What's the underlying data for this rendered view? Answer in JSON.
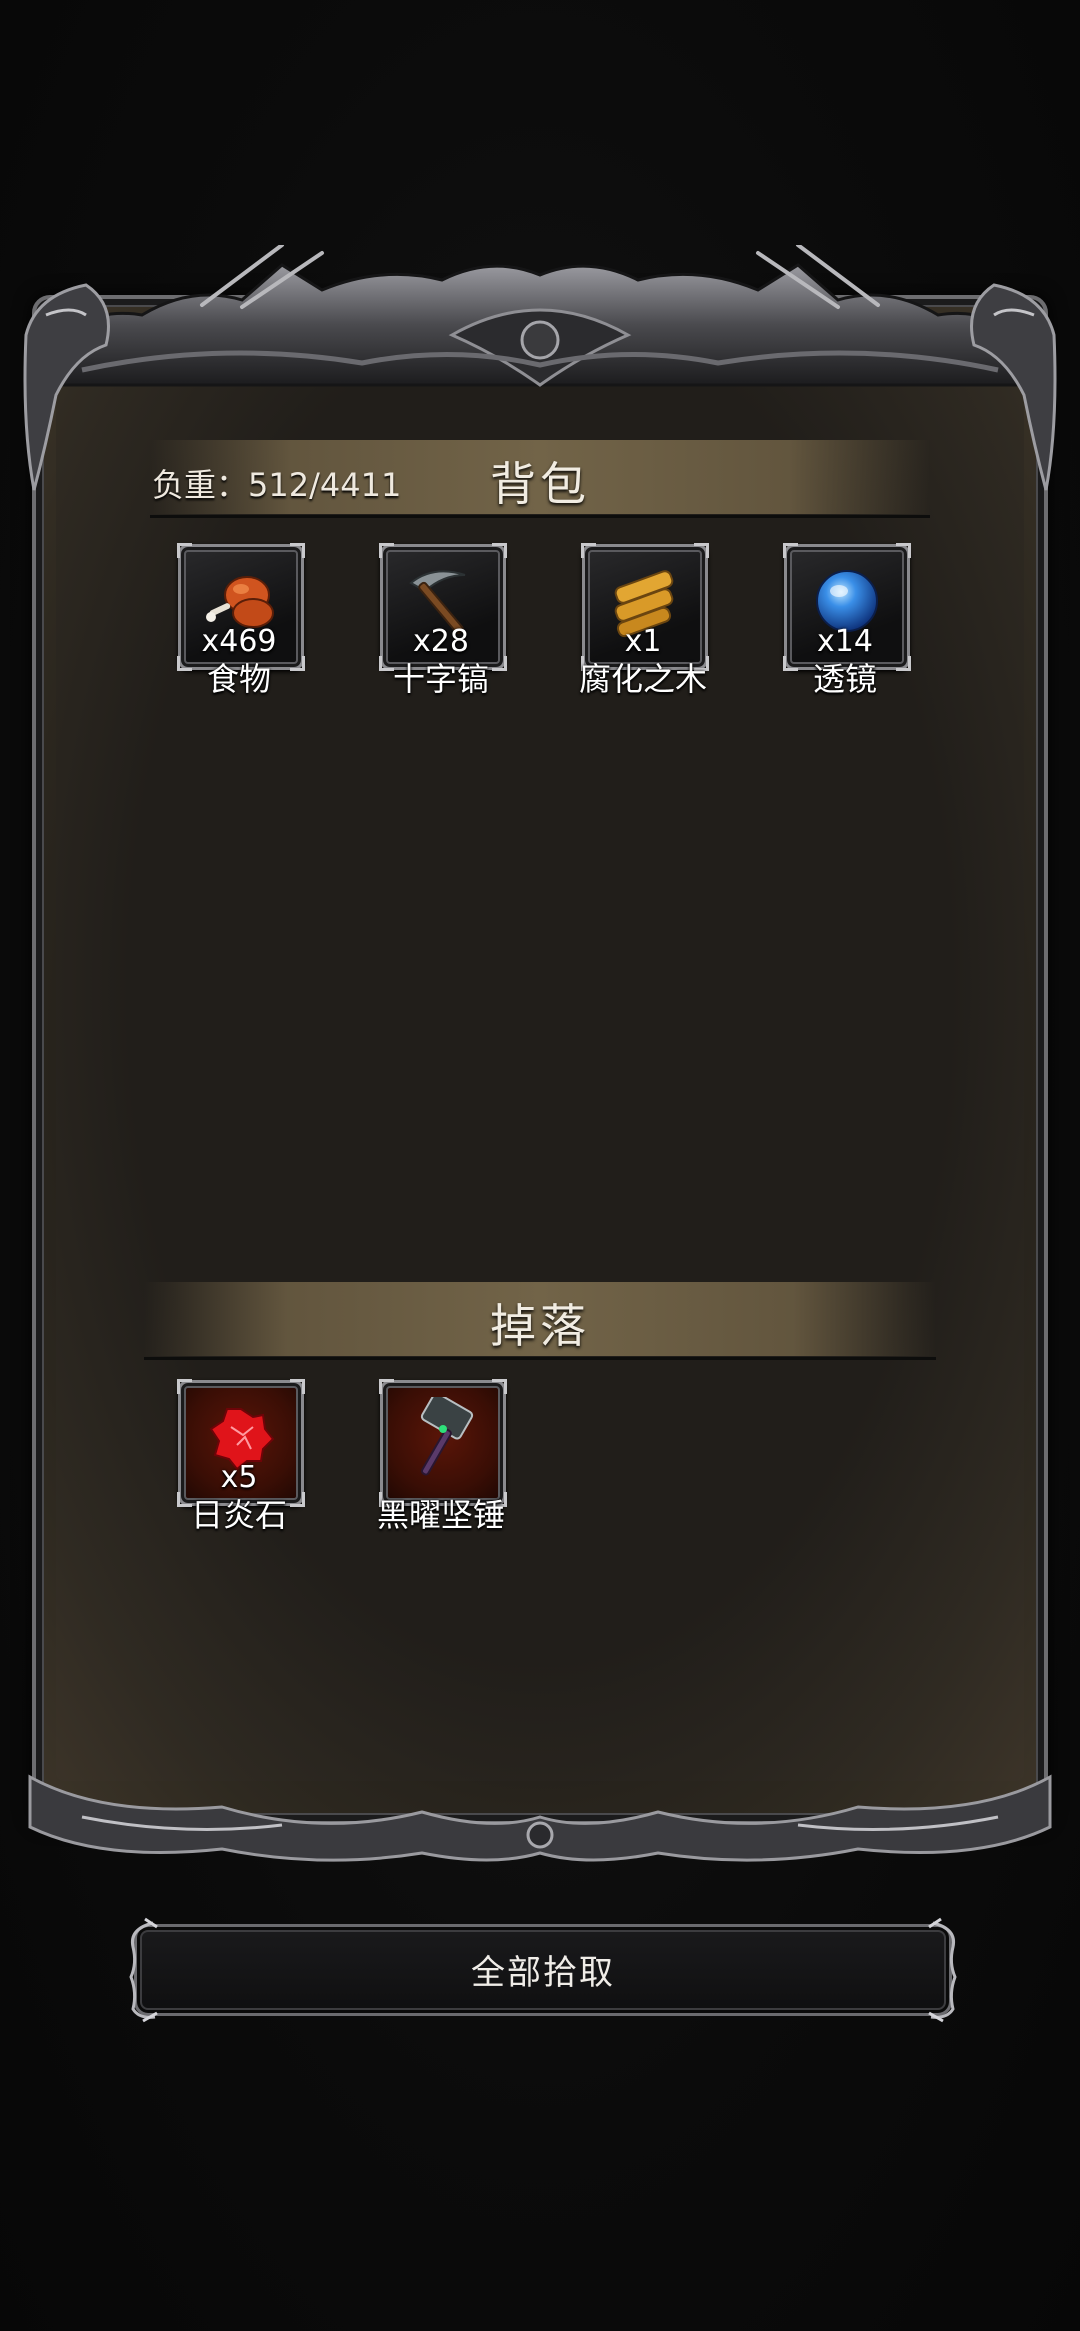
{
  "inventory": {
    "weight_label": "负重：512/4411",
    "title": "背包",
    "items": [
      {
        "name": "食物",
        "count": "x469",
        "icon": "meat-drumstick-icon"
      },
      {
        "name": "十字镐",
        "count": "x28",
        "icon": "pickaxe-icon"
      },
      {
        "name": "腐化之木",
        "count": "x1",
        "icon": "wood-log-icon"
      },
      {
        "name": "透镜",
        "count": "x14",
        "icon": "blue-lens-orb-icon"
      }
    ]
  },
  "drops": {
    "title": "掉落",
    "items": [
      {
        "name": "日炎石",
        "count": "x5",
        "icon": "red-sunfire-stone-icon"
      },
      {
        "name": "黑曜坚锤",
        "count": "",
        "icon": "obsidian-hammer-icon"
      }
    ]
  },
  "actions": {
    "collect_all_label": "全部拾取"
  },
  "colors": {
    "background": "#0b0b0b",
    "panel_fill": "#211e1a",
    "header_band": "#807050",
    "frame_silver": "#8a8a8e",
    "drop_slot_red": "#5a1508",
    "text": "#ffffff"
  }
}
